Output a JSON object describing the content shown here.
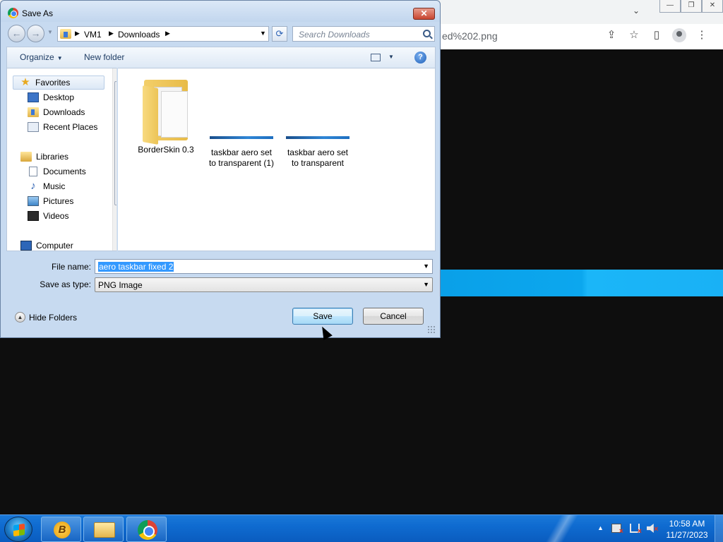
{
  "browser": {
    "url_fragment": "ed%202.png",
    "window_controls": [
      "—",
      "❐",
      "✕"
    ],
    "tab_menu": "⌄",
    "icons": [
      "share-icon",
      "star-icon",
      "sidepanel-icon",
      "profile-icon",
      "menu-icon"
    ]
  },
  "dialog": {
    "title": "Save As",
    "close_glyph": "✕",
    "nav": {
      "back_glyph": "←",
      "forward_glyph": "→",
      "breadcrumb": [
        "VM1",
        "Downloads"
      ],
      "refresh_glyph": "⟳"
    },
    "search_placeholder": "Search Downloads",
    "toolbar": {
      "organize": "Organize",
      "new_folder": "New folder",
      "help_glyph": "?"
    },
    "nav_pane": [
      {
        "label": "Favorites",
        "icon": "star-icon"
      },
      {
        "label": "Desktop",
        "icon": "desktop-icon"
      },
      {
        "label": "Downloads",
        "icon": "downloads-folder-icon"
      },
      {
        "label": "Recent Places",
        "icon": "recent-places-icon"
      },
      {
        "label": "Libraries",
        "icon": "libraries-icon"
      },
      {
        "label": "Documents",
        "icon": "documents-icon"
      },
      {
        "label": "Music",
        "icon": "music-icon"
      },
      {
        "label": "Pictures",
        "icon": "pictures-icon"
      },
      {
        "label": "Videos",
        "icon": "videos-icon"
      },
      {
        "label": "Computer",
        "icon": "computer-icon"
      }
    ],
    "files": [
      {
        "name": "BorderSkin 0.3",
        "kind": "folder"
      },
      {
        "name_line1": "taskbar aero set",
        "name_line2": "to transparent (1)",
        "kind": "image"
      },
      {
        "name_line1": "taskbar aero set",
        "name_line2": "to transparent",
        "kind": "image"
      }
    ],
    "file_name_label": "File name:",
    "file_name_value": "aero taskbar fixed 2",
    "save_type_label": "Save as type:",
    "save_type_value": "PNG Image",
    "hide_folders": "Hide Folders",
    "save_button": "Save",
    "cancel_button": "Cancel"
  },
  "taskbar": {
    "bitcoin_glyph": "B",
    "clock_time": "10:58 AM",
    "clock_date": "11/27/2023",
    "tray_chevron": "▲"
  },
  "colors": {
    "taskbar": "#0f6bd0",
    "selection": "#3399ff",
    "preview_strip": "#0ca7ee"
  }
}
